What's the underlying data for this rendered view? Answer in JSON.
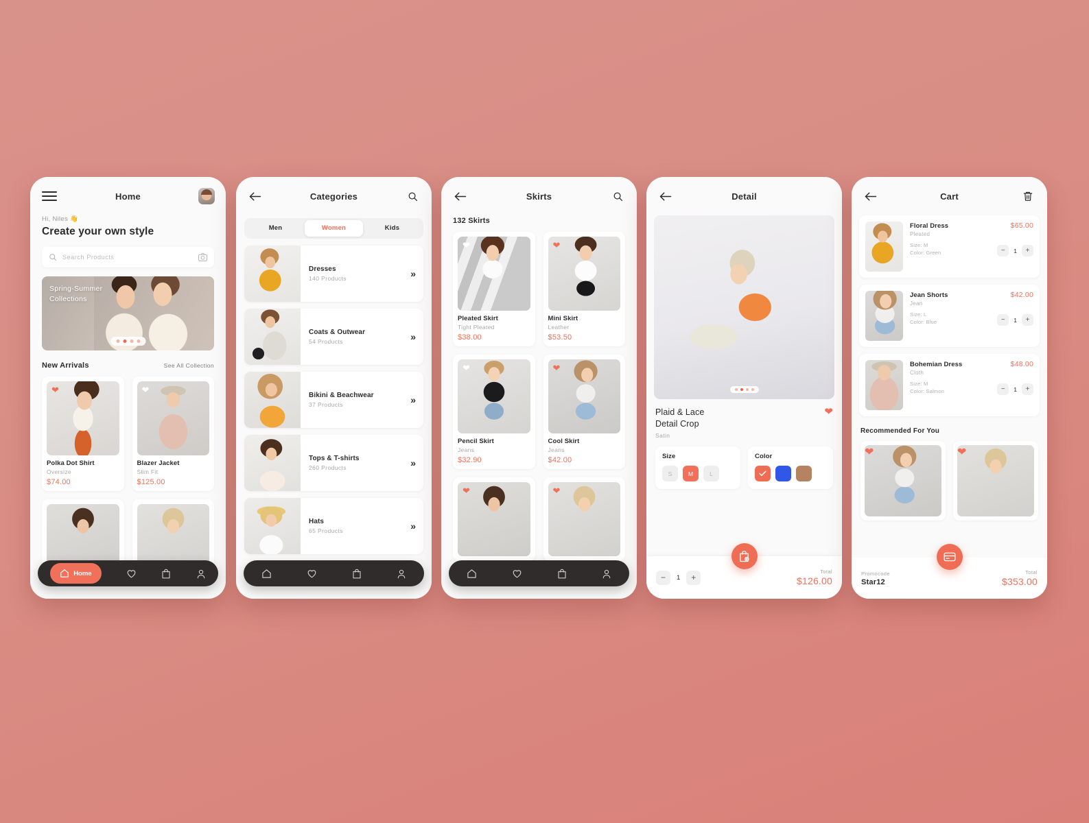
{
  "theme": {
    "background": "#d98b83",
    "accent": "#f0705a",
    "nav_dark": "#2f2c2b",
    "text_dark": "#2b2b2b",
    "text_muted": "#a8a8a8"
  },
  "home": {
    "title": "Home",
    "greeting": "Hi, Niles 👋",
    "headline": "Create your own style",
    "search_placeholder": "Search Products",
    "banner_title": "Spring-Summer\nCollections",
    "banner_dots": 4,
    "banner_active_dot": 1,
    "section_title": "New Arrivals",
    "see_all": "See All Collection",
    "products": [
      {
        "name": "Polka Dot Shirt",
        "sub": "Oversize",
        "price": "$74.00",
        "liked": true
      },
      {
        "name": "Blazer Jacket",
        "sub": "Slim Fit",
        "price": "$125.00",
        "liked": false
      }
    ],
    "nav": [
      {
        "icon": "home-icon",
        "label": "Home",
        "active": true
      },
      {
        "icon": "heart-icon",
        "label": "",
        "active": false
      },
      {
        "icon": "bag-icon",
        "label": "",
        "active": false
      },
      {
        "icon": "person-icon",
        "label": "",
        "active": false
      }
    ]
  },
  "categories": {
    "title": "Categories",
    "tabs": [
      {
        "label": "Men",
        "active": false
      },
      {
        "label": "Women",
        "active": true
      },
      {
        "label": "Kids",
        "active": false
      }
    ],
    "items": [
      {
        "name": "Dresses",
        "count": "140 Products"
      },
      {
        "name": "Coats & Outwear",
        "count": "54 Products"
      },
      {
        "name": "Bikini & Beachwear",
        "count": "37 Products"
      },
      {
        "name": "Tops & T-shirts",
        "count": "260 Products"
      },
      {
        "name": "Hats",
        "count": "65 Products"
      }
    ],
    "chevron": "»"
  },
  "skirts": {
    "title": "Skirts",
    "count": "132 Skirts",
    "products": [
      {
        "name": "Pleated Skirt",
        "sub": "Tight Pleated",
        "price": "$38.00",
        "liked": false
      },
      {
        "name": "Mini Skirt",
        "sub": "Leather",
        "price": "$53.50",
        "liked": true
      },
      {
        "name": "Pencil Skirt",
        "sub": "Jeans",
        "price": "$32.90",
        "liked": false
      },
      {
        "name": "Cool Skirt",
        "sub": "Jeans",
        "price": "$42.00",
        "liked": true
      }
    ]
  },
  "detail": {
    "title": "Detail",
    "product_title": "Plaid & Lace\nDetail Crop",
    "material": "Satin",
    "liked": true,
    "gallery_dots": 4,
    "gallery_active_dot": 1,
    "size_label": "Size",
    "sizes": [
      {
        "label": "S",
        "selected": false
      },
      {
        "label": "M",
        "selected": true
      },
      {
        "label": "L",
        "selected": false
      }
    ],
    "color_label": "Color",
    "colors": [
      {
        "hex": "#ef6d55",
        "selected": true
      },
      {
        "hex": "#3157e8",
        "selected": false
      },
      {
        "hex": "#b58360",
        "selected": false
      }
    ],
    "fab_icon": "add-to-bag-icon",
    "quantity": "1",
    "total_label": "Total",
    "total_value": "$126.00"
  },
  "cart": {
    "title": "Cart",
    "delete_icon": "trash-icon",
    "items": [
      {
        "name": "Floral Dress",
        "sub": "Pleated",
        "price": "$65.00",
        "size": "Size: M",
        "color": "Color: Green",
        "qty": "1"
      },
      {
        "name": "Jean Shorts",
        "sub": "Jean",
        "price": "$42.00",
        "size": "Size: L",
        "color": "Color: Blue",
        "qty": "1"
      },
      {
        "name": "Bohemian Dress",
        "sub": "Cloth",
        "price": "$48.00",
        "size": "Size: M",
        "color": "Color: Salmon",
        "qty": "1"
      }
    ],
    "recommended_title": "Recommended For You",
    "recommended": [
      {
        "liked": true
      },
      {
        "liked": true
      }
    ],
    "fab_icon": "card-icon",
    "promocode_label": "Promocode",
    "promocode_value": "Star12",
    "total_label": "Total",
    "total_value": "$353.00"
  }
}
